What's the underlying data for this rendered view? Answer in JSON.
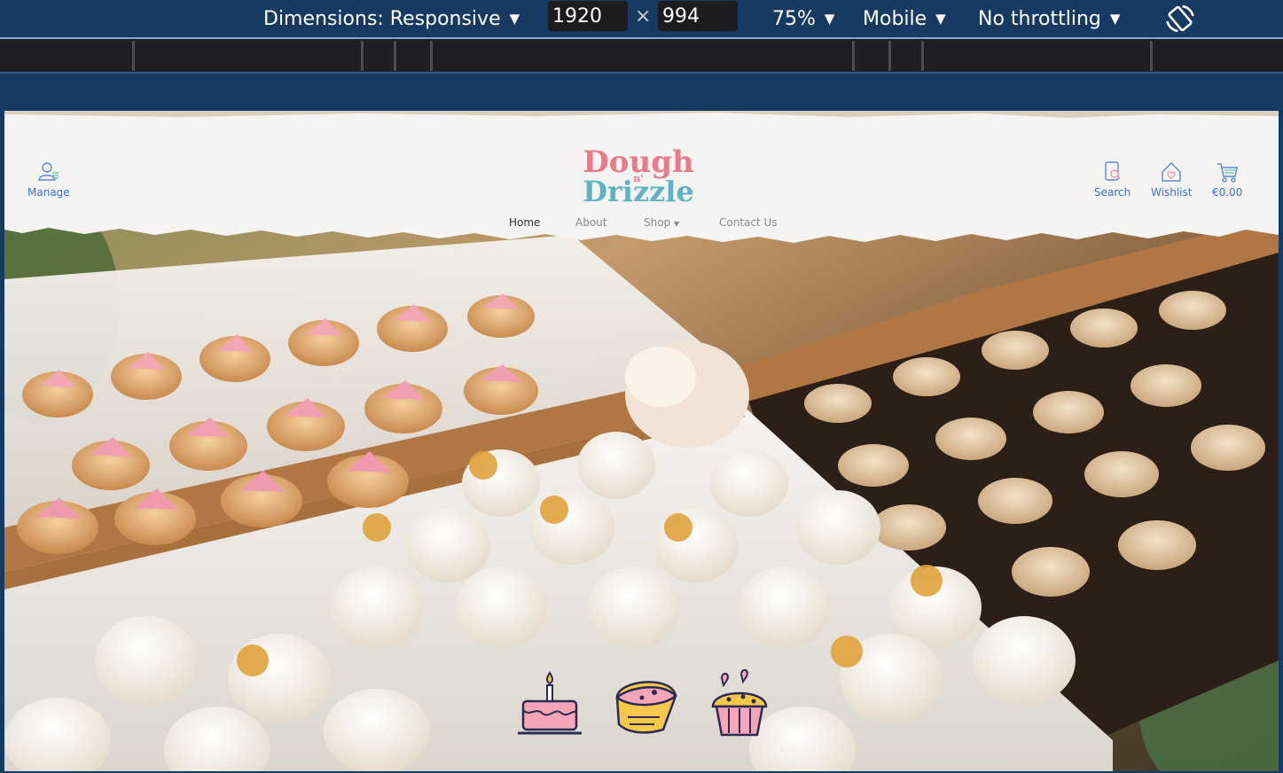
{
  "devtools": {
    "dimensions_label": "Dimensions: Responsive",
    "width": "1920",
    "height": "994",
    "times": "×",
    "zoom": "75%",
    "device": "Mobile",
    "throttling": "No throttling",
    "icons": [
      "caret-down-icon",
      "rotate-icon"
    ]
  },
  "site": {
    "logo": {
      "line1": "Dough",
      "line2": "n'",
      "line3": "Drizzle"
    },
    "header": {
      "manage": "Manage",
      "search": "Search",
      "wishlist": "Wishlist",
      "cart_total": "€0.00"
    },
    "nav": [
      {
        "label": "Home"
      },
      {
        "label": "About"
      },
      {
        "label": "Shop"
      },
      {
        "label": "Contact Us"
      }
    ],
    "hero_icons": [
      "birthday-cake-icon",
      "cake-slice-icon",
      "cupcake-icon"
    ],
    "colors": {
      "accent": "#3a6fd0",
      "logo_pink": "#e87a8a",
      "logo_teal": "#5fb3c3",
      "icon_pink": "#f4a6b8",
      "icon_yellow": "#f6c84a",
      "icon_outline": "#2b2a52"
    }
  }
}
